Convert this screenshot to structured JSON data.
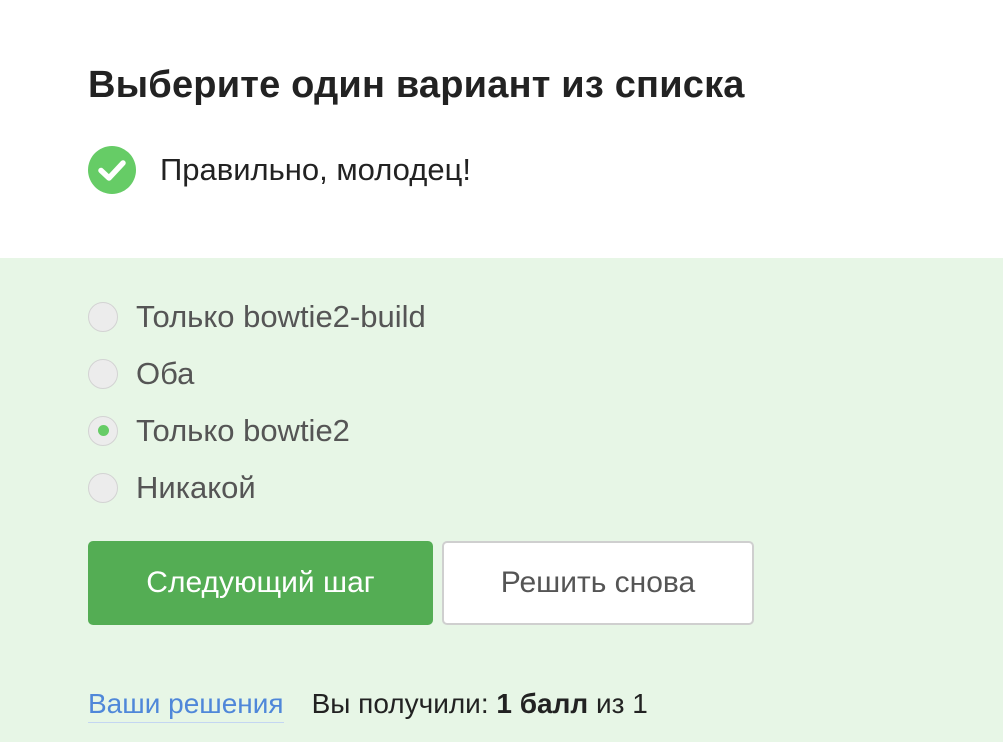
{
  "question": {
    "title": "Выберите один вариант из списка"
  },
  "feedback": {
    "icon": "check-circle-icon",
    "icon_color": "#66cc66",
    "text": "Правильно, молодец!"
  },
  "options": [
    {
      "label": "Только bowtie2-build",
      "selected": false
    },
    {
      "label": "Оба",
      "selected": false
    },
    {
      "label": "Только bowtie2",
      "selected": true
    },
    {
      "label": "Никакой",
      "selected": false
    }
  ],
  "buttons": {
    "next_label": "Следующий шаг",
    "retry_label": "Решить снова"
  },
  "footer": {
    "solutions_link": "Ваши решения",
    "score_prefix": "Вы получили:",
    "score_value": "1 балл",
    "score_suffix": "из 1"
  },
  "colors": {
    "answer_area_bg": "#e7f6e6",
    "primary_button": "#54ad54",
    "link": "#4f87d9",
    "radio_selected_dot": "#66cc66"
  }
}
